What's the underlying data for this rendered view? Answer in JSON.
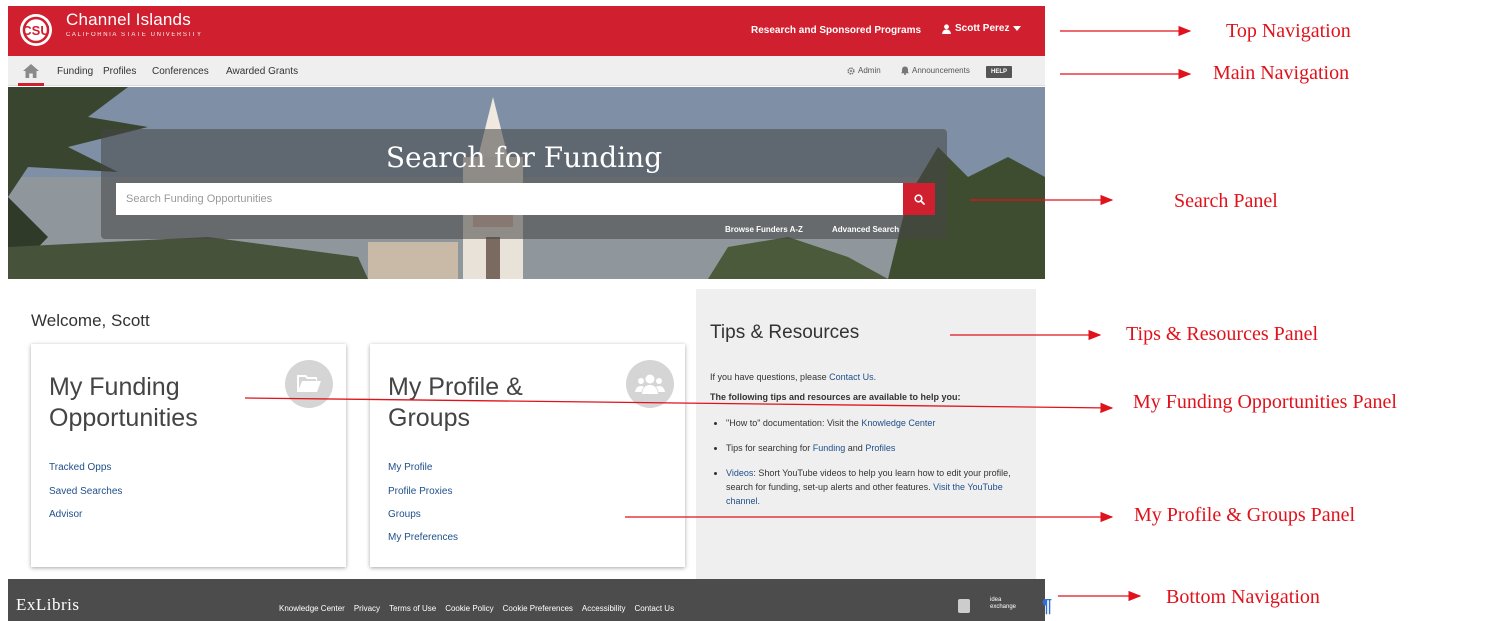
{
  "top_nav": {
    "brand_name": "Channel Islands",
    "brand_sub": "CALIFORNIA STATE UNIVERSITY",
    "research_link": "Research and Sponsored Programs",
    "user_name": "Scott Perez"
  },
  "main_nav": {
    "items": [
      "Funding",
      "Profiles",
      "Conferences",
      "Awarded Grants"
    ],
    "admin": "Admin",
    "announcements": "Announcements",
    "help": "HELP"
  },
  "search": {
    "title": "Search for Funding",
    "placeholder": "Search Funding Opportunities",
    "browse_link": "Browse Funders A-Z",
    "advanced_link": "Advanced Search"
  },
  "welcome": "Welcome, Scott",
  "funding_card": {
    "title_line1": "My Funding",
    "title_line2": "Opportunities",
    "links": [
      "Tracked Opps",
      "Saved Searches",
      "Advisor"
    ]
  },
  "profile_card": {
    "title_line1": "My Profile &",
    "title_line2": "Groups",
    "links": [
      "My Profile",
      "Profile Proxies",
      "Groups",
      "My Preferences"
    ]
  },
  "tips": {
    "title": "Tips & Resources",
    "questions_prefix": "If you have questions, please",
    "contact_link": "Contact Us.",
    "intro": "The following tips and resources are available to help you:",
    "item1_prefix": "\"How to\" documentation: Visit the",
    "item1_link": "Knowledge Center",
    "item2_prefix": "Tips for searching for",
    "item2_link1": "Funding",
    "item2_and": "and",
    "item2_link2": "Profiles",
    "item3_link": "Videos",
    "item3_text": ": Short YouTube videos to help you learn how to edit your profile, search for funding, set-up alerts and other features.",
    "item3_link2": "Visit the YouTube channel."
  },
  "footer": {
    "brand": "ExLibris",
    "links": [
      "Knowledge Center",
      "Privacy",
      "Terms of Use",
      "Cookie Policy",
      "Cookie Preferences",
      "Accessibility",
      "Contact Us"
    ],
    "idea_line1": "idea",
    "idea_line2": "exchange",
    "pilcrow": "¶"
  },
  "annotations": {
    "top_navigation": "Top Navigation",
    "main_navigation": "Main Navigation",
    "search_panel": "Search Panel",
    "tips_panel": "Tips & Resources Panel",
    "funding_panel": "My Funding Opportunities Panel",
    "profile_panel": "My Profile & Groups Panel",
    "bottom_navigation": "Bottom Navigation"
  },
  "colors": {
    "brand_red": "#d01f2f",
    "annotation_red": "#e0121b",
    "link_blue": "#1f4f8a",
    "footer_gray": "#4c4c4c"
  }
}
